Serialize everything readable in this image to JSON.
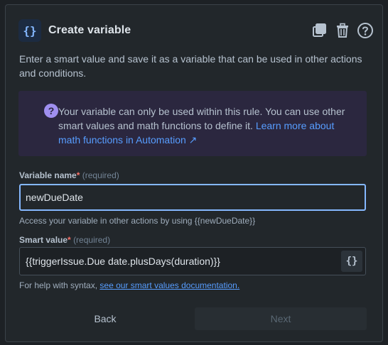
{
  "header": {
    "icon_label": "{}",
    "title": "Create variable",
    "actions": [
      {
        "name": "duplicate-icon"
      },
      {
        "name": "trash-icon"
      },
      {
        "name": "help-icon"
      }
    ]
  },
  "description": "Enter a smart value and save it as a variable that can be used in other actions and conditions.",
  "info": {
    "text": "Your variable can only be used within this rule. You can use other smart values and math functions to define it. ",
    "link": "Learn more about math functions in Automation ↗"
  },
  "variable_name": {
    "label": "Variable name",
    "required_star": "*",
    "required": "(required)",
    "value": "newDueDate",
    "help": "Access your variable in other actions by using {{newDueDate}}"
  },
  "smart_value": {
    "label": "Smart value",
    "required_star": "*",
    "required": "(required)",
    "value": "{{triggerIssue.Due date.plusDays(duration)}}",
    "button_label": "{}",
    "help_prefix": "For help with syntax, ",
    "help_link": "see our smart values documentation."
  },
  "footer": {
    "back_label": "Back",
    "next_label": "Next"
  },
  "colors": {
    "accent": "#85b8ff",
    "info_bg": "#2b273f",
    "link": "#579dff",
    "required": "#f87168"
  }
}
